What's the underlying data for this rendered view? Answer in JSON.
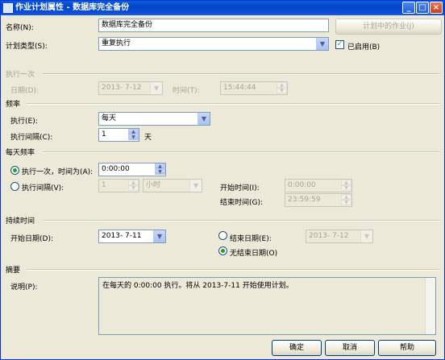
{
  "window": {
    "title": "作业计划属性 - 数据库完全备份",
    "controls": [
      "_",
      "□",
      "×"
    ]
  },
  "name_row": {
    "label": "名称(N):",
    "value": "数据库完全备份",
    "jobs_button": "计划中的作业(J)"
  },
  "schedule_type": {
    "label": "计划类型(S):",
    "value": "重复执行",
    "enabled_label": "已启用(B)",
    "enabled": true
  },
  "once": {
    "section": "执行一次",
    "date_label": "日期(D):",
    "date_value": "2013- 7-12",
    "time_label": "时间(T):",
    "time_value": "15:44:44"
  },
  "frequency": {
    "section": "频率",
    "occurs_label": "执行(E):",
    "occurs_value": "每天",
    "recurs_label": "执行间隔(C):",
    "recurs_value": "1",
    "recurs_unit": "天"
  },
  "daily": {
    "section": "每天频率",
    "once_label": "执行一次，时间为(A):",
    "once_value": "0:00:00",
    "every_label": "执行间隔(V):",
    "every_value": "1",
    "every_unit": "小时",
    "start_label": "开始时间(I):",
    "start_value": "0:00:00",
    "end_label": "结束时间(G):",
    "end_value": "23:59:59"
  },
  "duration": {
    "section": "持续时间",
    "start_label": "开始日期(D):",
    "start_value": "2013- 7-11",
    "end_label": "结束日期(E):",
    "end_value": "2013- 7-12",
    "no_end_label": "无结束日期(O)"
  },
  "summary": {
    "section": "摘要",
    "desc_label": "说明(P):",
    "desc_value": "在每天的 0:00:00 执行。将从 2013-7-11 开始使用计划。"
  },
  "buttons": {
    "ok": "确定",
    "cancel": "取消",
    "help": "帮助"
  }
}
